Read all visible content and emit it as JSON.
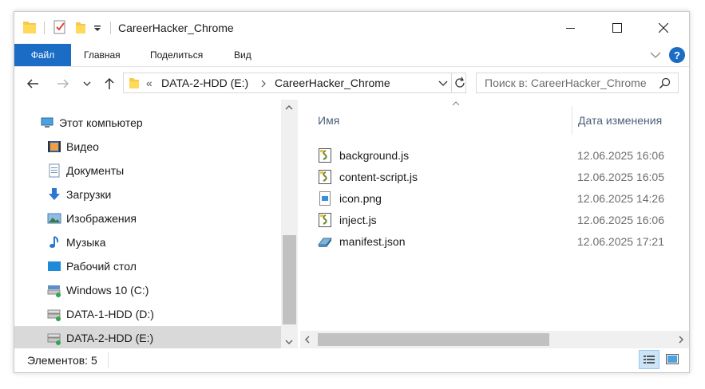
{
  "window": {
    "title": "CareerHacker_Chrome"
  },
  "ribbon": {
    "tabs": [
      "Файл",
      "Главная",
      "Поделиться",
      "Вид"
    ],
    "help": "?"
  },
  "address": {
    "root_glyph": "«",
    "segments": [
      "DATA-2-HDD (E:)",
      "CareerHacker_Chrome"
    ]
  },
  "search": {
    "placeholder": "Поиск в: CareerHacker_Chrome"
  },
  "nav": {
    "items": [
      {
        "label": "Этот компьютер",
        "icon": "computer-icon"
      },
      {
        "label": "Видео",
        "icon": "video-icon"
      },
      {
        "label": "Документы",
        "icon": "documents-icon"
      },
      {
        "label": "Загрузки",
        "icon": "downloads-icon"
      },
      {
        "label": "Изображения",
        "icon": "pictures-icon"
      },
      {
        "label": "Музыка",
        "icon": "music-icon"
      },
      {
        "label": "Рабочий стол",
        "icon": "desktop-icon"
      },
      {
        "label": "Windows 10 (C:)",
        "icon": "drive-icon"
      },
      {
        "label": "DATA-1-HDD (D:)",
        "icon": "drive-icon"
      },
      {
        "label": "DATA-2-HDD (E:)",
        "icon": "drive-icon",
        "selected": true
      }
    ]
  },
  "list": {
    "columns": {
      "name": "Имя",
      "date": "Дата изменения"
    },
    "files": [
      {
        "name": "background.js",
        "date": "12.06.2025 16:06",
        "icon": "js-file-icon"
      },
      {
        "name": "content-script.js",
        "date": "12.06.2025 16:05",
        "icon": "js-file-icon"
      },
      {
        "name": "icon.png",
        "date": "12.06.2025 14:26",
        "icon": "png-file-icon"
      },
      {
        "name": "inject.js",
        "date": "12.06.2025 16:06",
        "icon": "js-file-icon"
      },
      {
        "name": "manifest.json",
        "date": "12.06.2025 17:21",
        "icon": "json-file-icon"
      }
    ]
  },
  "status": {
    "items_text": "Элементов: 5"
  },
  "colors": {
    "accent": "#1a6cc4",
    "selection": "#d9d9d9",
    "header_text": "#4c607a"
  }
}
